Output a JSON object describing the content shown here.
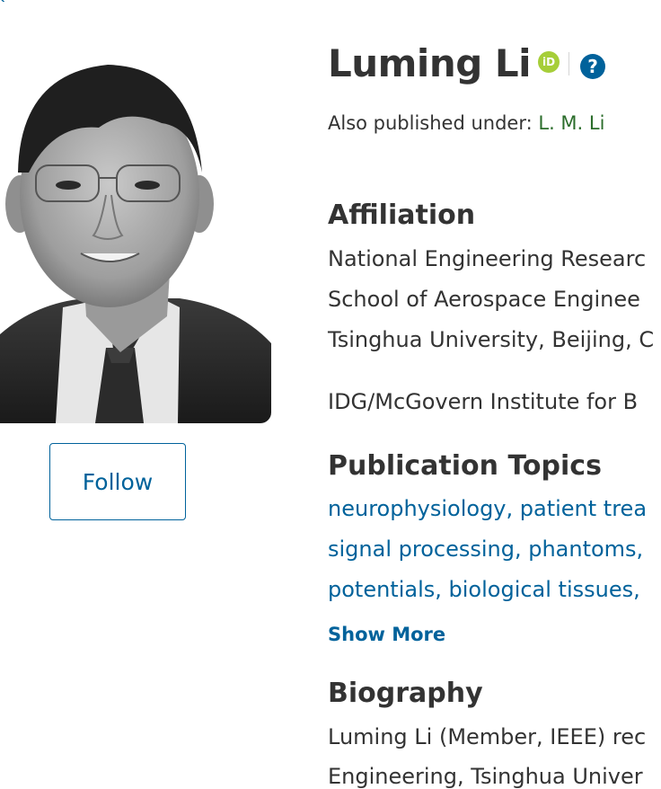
{
  "corner_link": "k",
  "profile": {
    "name": "Luming Li",
    "orcid_icon_text": "iD",
    "help_icon_text": "?",
    "also_published_label": "Also published under: ",
    "also_published_name": "L. M. Li",
    "follow_label": "Follow"
  },
  "affiliation": {
    "title": "Affiliation",
    "lines": [
      "National Engineering Researc",
      "School of Aerospace Enginee",
      "Tsinghua University, Beijing, C",
      "IDG/McGovern Institute for B"
    ]
  },
  "topics": {
    "title": "Publication Topics",
    "lines": [
      "neurophysiology, patient trea",
      "signal processing, phantoms,",
      "potentials, biological tissues,"
    ],
    "show_more": "Show More"
  },
  "biography": {
    "title": "Biography",
    "lines": [
      "Luming Li (Member, IEEE) rec",
      "Engineering, Tsinghua Univer"
    ]
  }
}
